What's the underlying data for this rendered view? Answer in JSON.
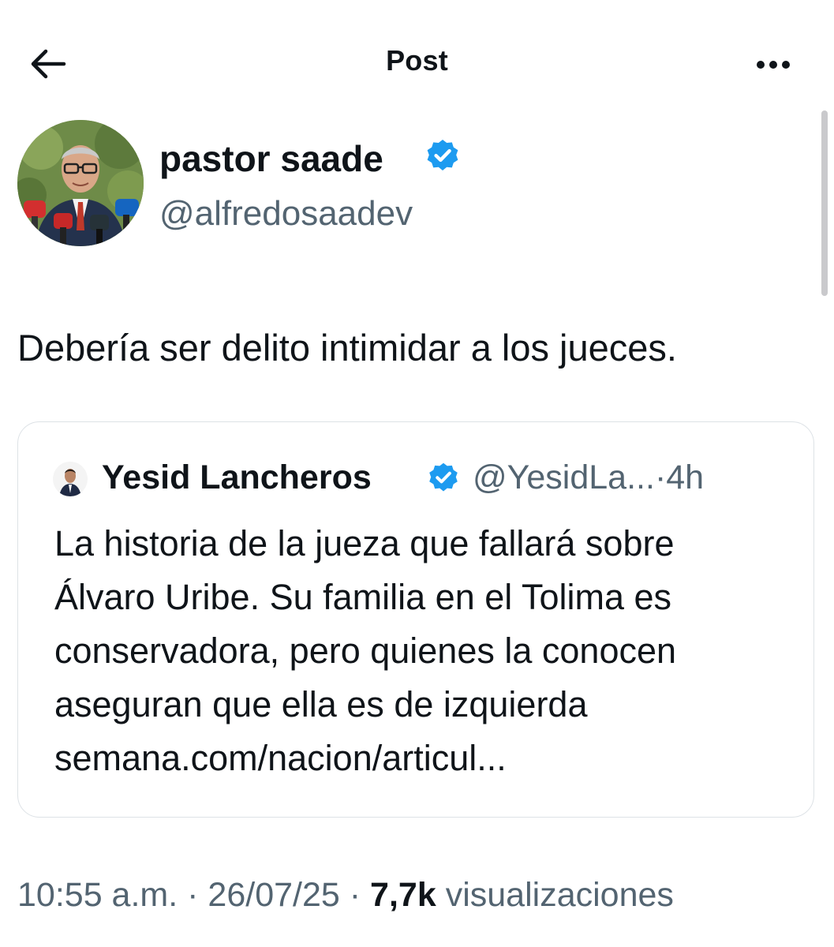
{
  "header": {
    "title": "Post",
    "back_icon": "arrow-left-icon",
    "more_icon": "more-horizontal-icon"
  },
  "author": {
    "name": "pastor saade",
    "handle": "@alfredosaadev",
    "verified": true,
    "verified_color": "#1d9bf0"
  },
  "tweet": {
    "text": "Debería ser delito intimidar a los jueces."
  },
  "quoted_tweet": {
    "name": "Yesid Lancheros",
    "handle": "@YesidLa...",
    "separator": "·",
    "time": "4h",
    "text_lines": [
      "La historia de la jueza que fallará sobre",
      "Álvaro Uribe. Su familia en el Tolima es",
      "conservadora, pero quienes la conocen",
      "aseguran que ella es de izquierda",
      "semana.com/nacion/articul..."
    ]
  },
  "meta": {
    "time": "10:55 a.m.",
    "separator": "·",
    "date": "26/07/25",
    "views_count": "7,7k",
    "views_label": "visualizaciones"
  }
}
